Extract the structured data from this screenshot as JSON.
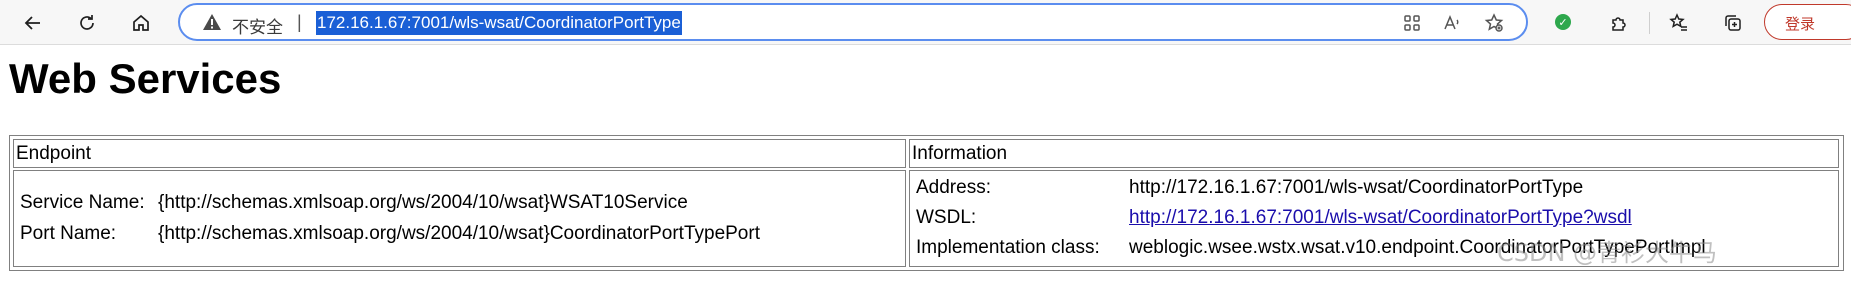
{
  "browser": {
    "insecure_label": "不安全",
    "separator": "|",
    "url": "172.16.1.67:7001/wls-wsat/CoordinatorPortType",
    "login_label": "登录",
    "icons": {
      "back": "back-arrow-icon",
      "refresh": "refresh-icon",
      "home": "home-icon",
      "warning": "warning-triangle-icon",
      "apps": "apps-grid-icon",
      "read_aloud": "read-aloud-icon",
      "favorite": "add-favorite-icon",
      "extension_status": "extension-check-icon",
      "extensions": "puzzle-extensions-icon",
      "favorites": "favorites-list-icon",
      "collections": "collections-icon"
    },
    "accent_color": "#1a5fd6"
  },
  "page": {
    "title": "Web Services"
  },
  "table": {
    "headers": [
      "Endpoint",
      "Information"
    ],
    "service_name_label": "Service Name:",
    "service_name_value": "{http://schemas.xmlsoap.org/ws/2004/10/wsat}WSAT10Service",
    "port_name_label": "Port Name:",
    "port_name_value": "{http://schemas.xmlsoap.org/ws/2004/10/wsat}CoordinatorPortTypePort",
    "address_label": "Address:",
    "address_value": "http://172.16.1.67:7001/wls-wsat/CoordinatorPortType",
    "wsdl_label": "WSDL:",
    "wsdl_value": "http://172.16.1.67:7001/wls-wsat/CoordinatorPortType?wsdl",
    "impl_label": "Implementation class:",
    "impl_value": "weblogic.wsee.wstx.wsat.v10.endpoint.CoordinatorPortTypePortImpl"
  },
  "watermark": "CSDN @青衫大牛马"
}
